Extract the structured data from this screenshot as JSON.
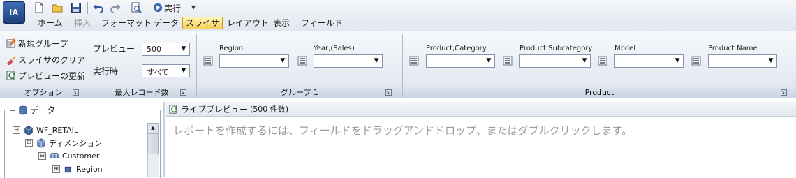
{
  "app": {
    "logo_text": "IA"
  },
  "quick_access": {
    "run_label": "実行"
  },
  "ribbon_tabs": [
    {
      "label": "ホーム"
    },
    {
      "label": "挿入"
    },
    {
      "label": "フォーマット"
    },
    {
      "label": "データ"
    },
    {
      "label": "スライサ",
      "active": true
    },
    {
      "label": "レイアウト"
    },
    {
      "label": "表示"
    },
    {
      "label": "フィールド"
    }
  ],
  "options_group": {
    "items": [
      {
        "label": "新規グループ",
        "icon": "new-group-icon"
      },
      {
        "label": "スライサのクリア",
        "icon": "clear-slicer-icon"
      },
      {
        "label": "プレビューの更新",
        "icon": "refresh-preview-icon"
      }
    ],
    "footer": "オプション"
  },
  "max_records_group": {
    "preview_label": "プレビュー",
    "preview_value": "500",
    "runtime_label": "実行時",
    "runtime_value": "すべて",
    "footer": "最大レコード数"
  },
  "group1": {
    "fields": [
      {
        "label": "Region",
        "value": ""
      },
      {
        "label": "Year,(Sales)",
        "value": ""
      }
    ],
    "footer": "グループ 1"
  },
  "product_group": {
    "fields": [
      {
        "label": "Product,Category",
        "value": ""
      },
      {
        "label": "Product,Subcategory",
        "value": ""
      },
      {
        "label": "Model",
        "value": ""
      },
      {
        "label": "Product Name",
        "value": ""
      }
    ],
    "footer": "Product"
  },
  "data_panel": {
    "title": "データ",
    "tree": [
      {
        "label": "WF_RETAIL",
        "toggle": "⊟",
        "icon": "cube-icon"
      },
      {
        "label": "ディメンション",
        "toggle": "⊟",
        "icon": "dimension-icon"
      },
      {
        "label": "Customer",
        "toggle": "⊟",
        "icon": "hierarchy-icon"
      },
      {
        "label": "Region",
        "toggle": "⊞",
        "icon": "level-icon"
      }
    ]
  },
  "preview": {
    "title": "ライブプレビュー",
    "count": "(500 件数)",
    "message": "レポートを作成するには、フィールドをドラッグアンドドロップ、またはダブルクリックします。"
  },
  "colors": {
    "active_tab": "#f7cf55",
    "ribbon_bg": "#dfe5ee",
    "logo": "#1d3f7a"
  }
}
